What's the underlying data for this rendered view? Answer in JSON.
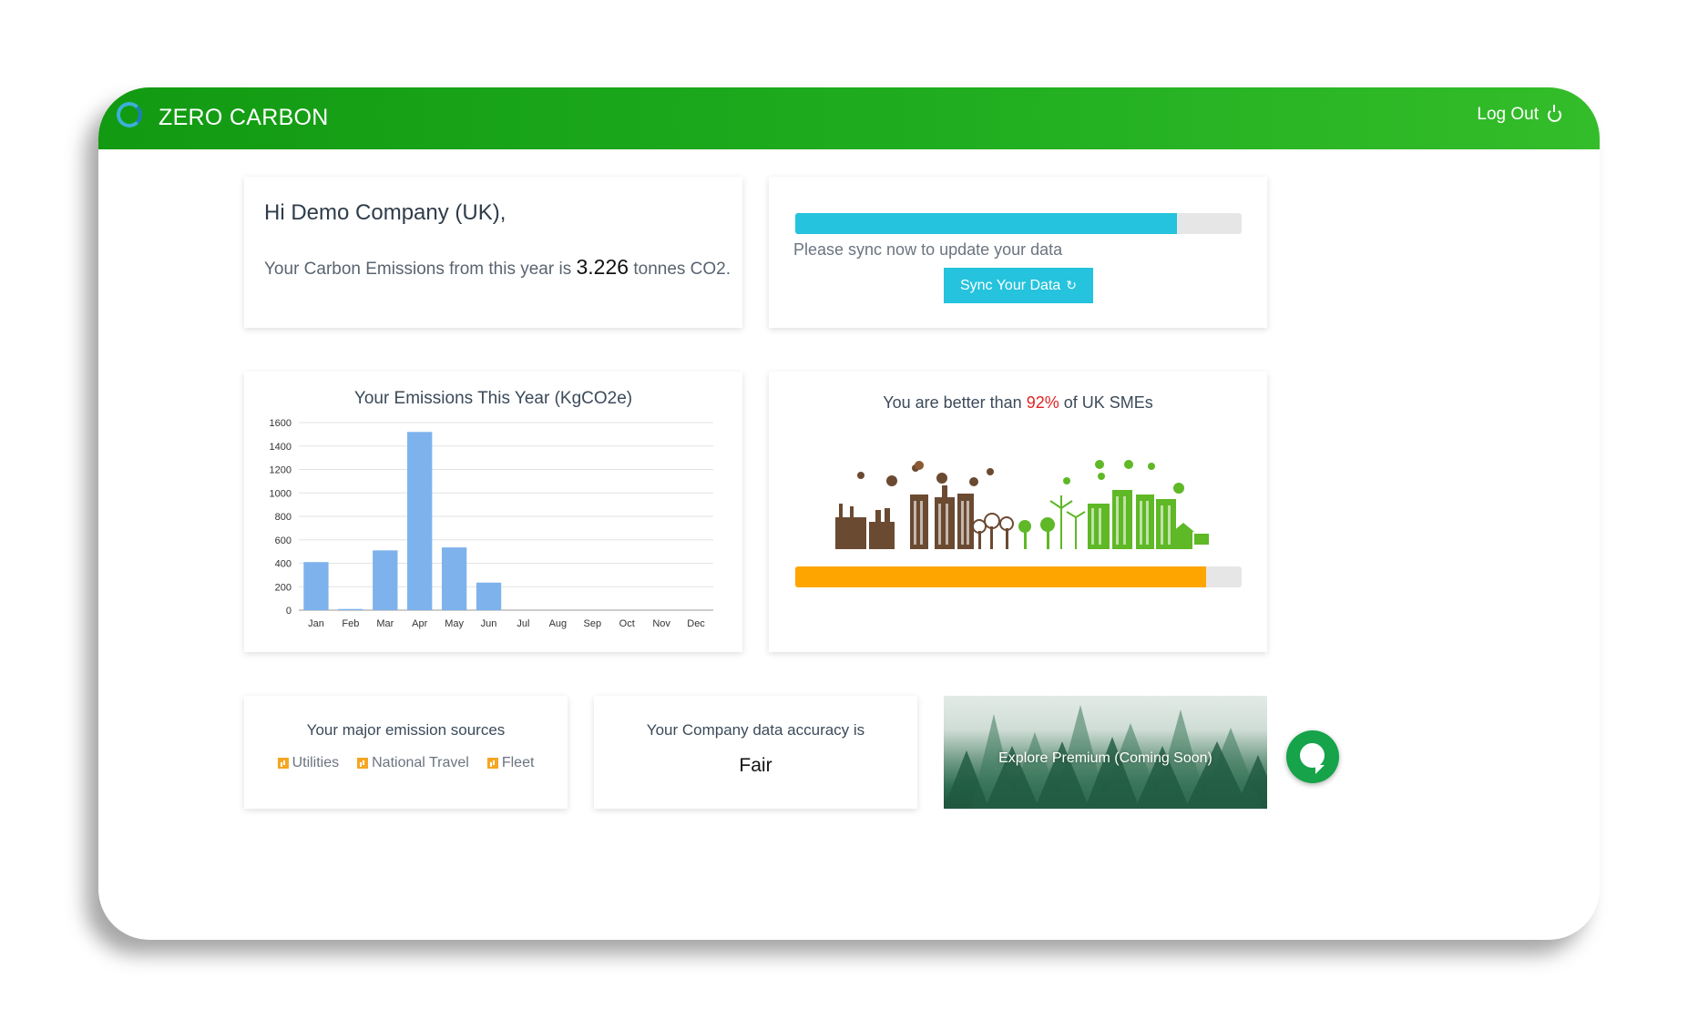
{
  "brand": {
    "name": "ZERO CARBON"
  },
  "header": {
    "logout_label": "Log Out"
  },
  "greeting": {
    "title": "Hi Demo Company (UK),",
    "emissions_prefix": "Your Carbon Emissions from this year is",
    "emissions_value": "3.226",
    "emissions_unit": "tonnes CO2."
  },
  "sync": {
    "progress": 0.855,
    "note": "Please sync now to update your data",
    "button_label": "Sync Your Data",
    "bar_color": "#25c3dd"
  },
  "comparison": {
    "title_prefix": "You are better than",
    "percent": "92%",
    "title_suffix": "of UK SMEs",
    "progress": 0.92,
    "bar_color": "#ffa500",
    "illustration": "city-pollution-to-green-icon"
  },
  "sources": {
    "title": "Your major emission sources",
    "items": [
      "Utilities",
      "National Travel",
      "Fleet"
    ]
  },
  "accuracy": {
    "title": "Your Company data accuracy is",
    "value": "Fair"
  },
  "premium": {
    "label": "Explore Premium (Coming Soon)"
  },
  "colors": {
    "accent_green": "#1fad1f",
    "chart_bar": "#7db2ec"
  },
  "chart_data": {
    "type": "bar",
    "title": "Your Emissions This Year (KgCO2e)",
    "categories": [
      "Jan",
      "Feb",
      "Mar",
      "Apr",
      "May",
      "Jun",
      "Jul",
      "Aug",
      "Sep",
      "Oct",
      "Nov",
      "Dec"
    ],
    "values": [
      410,
      10,
      510,
      1520,
      535,
      235,
      0,
      0,
      0,
      0,
      0,
      0
    ],
    "ylim": [
      0,
      1600
    ],
    "yticks": [
      0,
      200,
      400,
      600,
      800,
      1000,
      1200,
      1400,
      1600
    ],
    "grid": true,
    "xlabel": "",
    "ylabel": ""
  }
}
